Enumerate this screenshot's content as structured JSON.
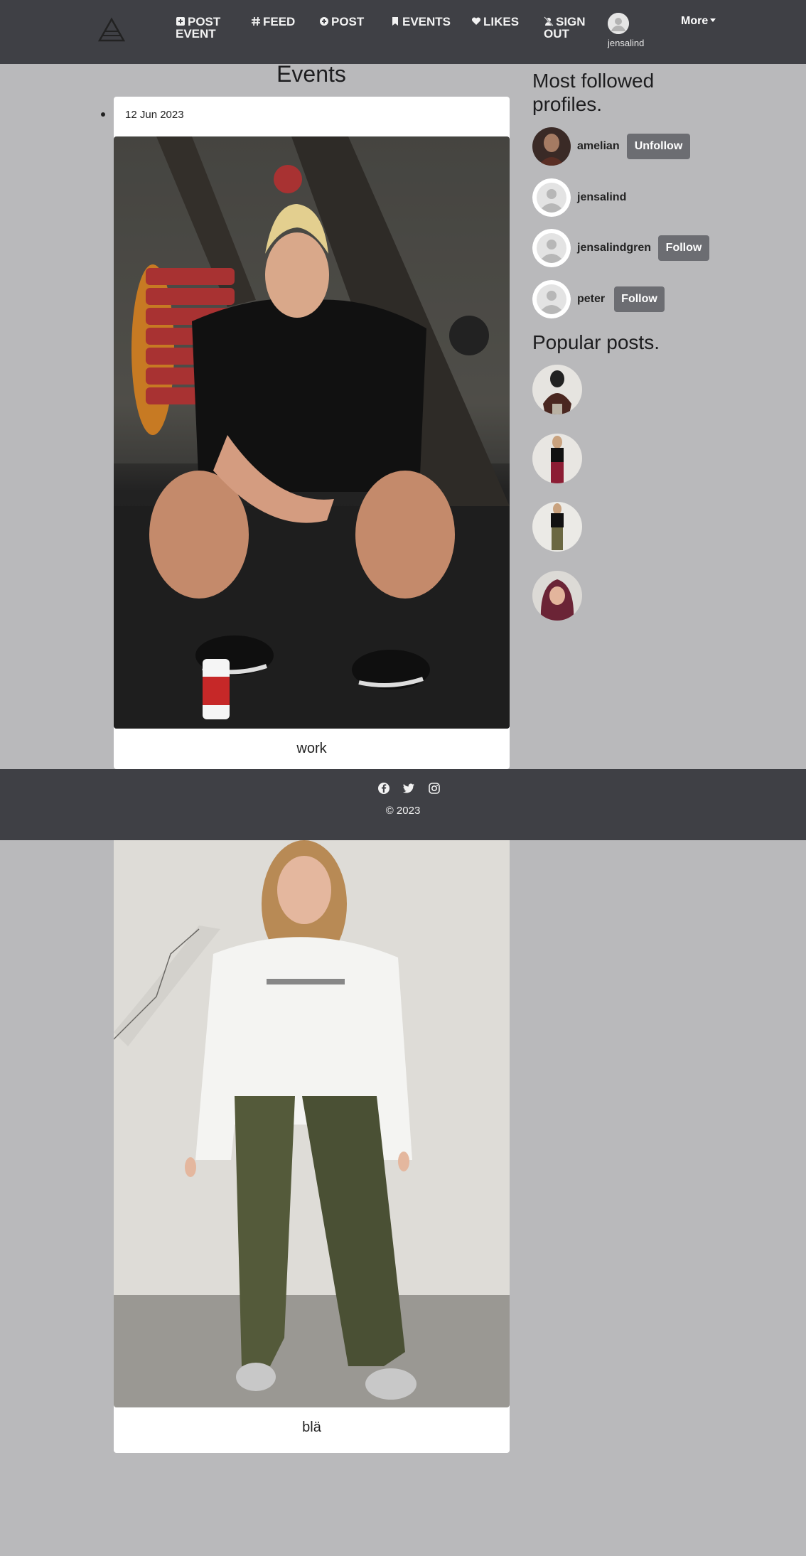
{
  "navbar": {
    "items": [
      {
        "label_line1": "POST",
        "label_line2": "EVENT",
        "icon": "plus-square-icon"
      },
      {
        "label": "FEED",
        "icon": "hash-icon"
      },
      {
        "label": "POST",
        "icon": "plus-circle-icon"
      },
      {
        "label": "EVENTS",
        "icon": "bookmark-icon"
      },
      {
        "label": "LIKES",
        "icon": "heart-icon"
      },
      {
        "label_line1": "SIGN",
        "label_line2": "OUT",
        "icon": "sign-out-icon"
      }
    ],
    "username": "jensalind",
    "more_label": "More"
  },
  "main": {
    "title": "Events",
    "events": [
      {
        "date": "12 Jun 2023",
        "caption": "work"
      },
      {
        "caption": "blä"
      }
    ]
  },
  "sidebar": {
    "profiles_heading_line1": "Most followed",
    "profiles_heading_line2": "profiles.",
    "profiles": [
      {
        "name": "amelian",
        "action": "Unfollow"
      },
      {
        "name": "jensalind",
        "action": ""
      },
      {
        "name": "jensalindgren",
        "action": "Follow"
      },
      {
        "name": "peter",
        "action": "Follow"
      }
    ],
    "posts_heading": "Popular posts."
  },
  "footer": {
    "copyright": "© 2023",
    "social_icons": [
      "facebook-icon",
      "twitter-icon",
      "instagram-icon"
    ]
  },
  "colors": {
    "navbar_bg": "#3f4045",
    "page_bg": "#b9b9bb",
    "button_bg": "#6c6d72"
  }
}
